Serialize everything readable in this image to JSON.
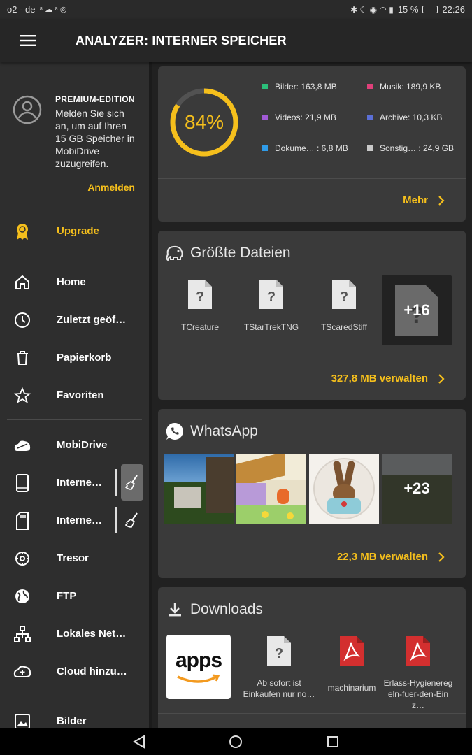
{
  "status": {
    "left": "o2 - de",
    "right_pct": "15 %",
    "time": "22:26"
  },
  "appbar": {
    "title": "ANALYZER: INTERNER SPEICHER"
  },
  "drawer": {
    "premium_title": "PREMIUM-EDITION",
    "premium_text": "Melden Sie sich an, um auf Ihren 15 GB Speicher in MobiDrive zuzugreifen.",
    "login": "Anmelden",
    "upgrade": "Upgrade",
    "items": [
      "Home",
      "Zuletzt geöf…",
      "Papierkorb",
      "Favoriten"
    ],
    "storage_items": [
      "MobiDrive",
      "Interne…",
      "Interne…",
      "Tresor",
      "FTP",
      "Lokales Net…",
      "Cloud hinzu…"
    ],
    "bottom_item": "Bilder"
  },
  "storage": {
    "percent": "84%",
    "percent_value": 84,
    "legend": [
      {
        "label": "Bilder: 163,8 MB",
        "color": "#2bbf7a"
      },
      {
        "label": "Musik: 189,9 KB",
        "color": "#e0407a"
      },
      {
        "label": "Videos: 21,9 MB",
        "color": "#a15ad6"
      },
      {
        "label": "Archive: 10,3 KB",
        "color": "#5b6fd6"
      },
      {
        "label": "Dokume… : 6,8 MB",
        "color": "#2f9be8"
      },
      {
        "label": "Sonstig… : 24,9 GB",
        "color": "#c9c9c9"
      }
    ],
    "more": "Mehr",
    "ring_color": "#f5bf1c"
  },
  "largest": {
    "title": "Größte Dateien",
    "files": [
      "TCreature",
      "TStarTrekTNG",
      "TScaredStiff"
    ],
    "more_count": "+16",
    "manage": "327,8 MB verwalten"
  },
  "whatsapp": {
    "title": "WhatsApp",
    "more_count": "+23",
    "manage": "22,3 MB verwalten"
  },
  "downloads": {
    "title": "Downloads",
    "app_logo": "apps",
    "files": [
      "Ab sofort ist Einkaufen nur no…",
      "machinarium",
      "Erlass-Hygieneregeln-fuer-den-Einz…"
    ]
  }
}
